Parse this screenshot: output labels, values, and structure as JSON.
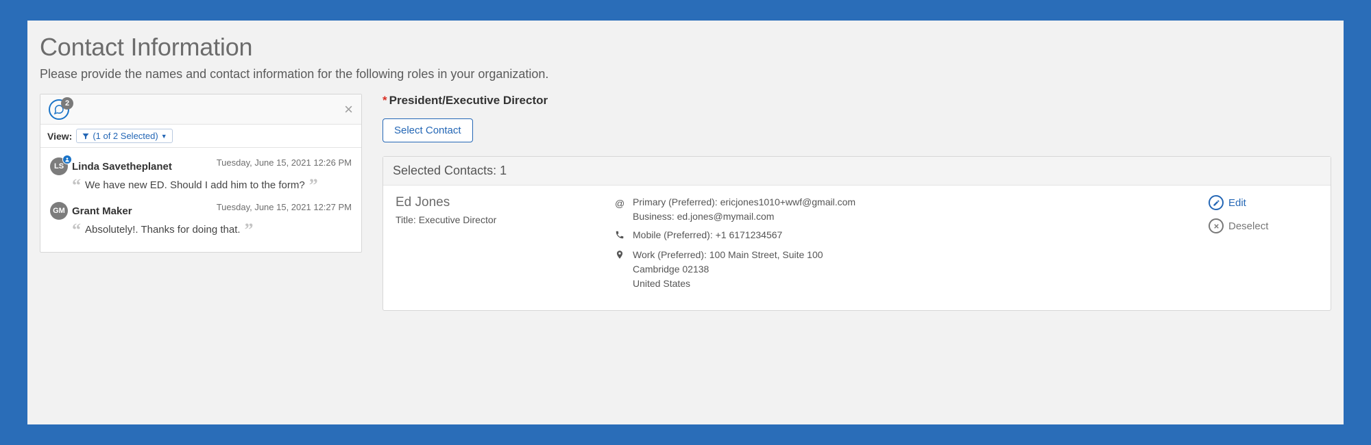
{
  "page": {
    "title": "Contact Information",
    "subtitle": "Please provide the names and contact information for the following roles in your organization."
  },
  "comments": {
    "badge_count": "2",
    "view_label": "View:",
    "filter_text": "(1 of 2 Selected)",
    "items": [
      {
        "initials": "LS",
        "has_user_badge": true,
        "name": "Linda Savetheplanet",
        "timestamp": "Tuesday, June 15, 2021 12:26 PM",
        "body": "We have new ED. Should I add him to the form?"
      },
      {
        "initials": "GM",
        "has_user_badge": false,
        "name": "Grant Maker",
        "timestamp": "Tuesday, June 15, 2021 12:27 PM",
        "body": "Absolutely!. Thanks for doing that."
      }
    ]
  },
  "role": {
    "label": "President/Executive Director",
    "select_button": "Select Contact"
  },
  "selected": {
    "header_prefix": "Selected Contacts:",
    "count": "1",
    "contact_name": "Ed Jones",
    "contact_title": "Title: Executive Director",
    "email_primary": "Primary (Preferred): ericjones1010+wwf@gmail.com",
    "email_business": "Business: ed.jones@mymail.com",
    "phone": "Mobile (Preferred): +1 6171234567",
    "address_line1": "Work (Preferred): 100 Main Street, Suite 100",
    "address_line2": "Cambridge 02138",
    "address_line3": "United States",
    "edit_label": "Edit",
    "deselect_label": "Deselect"
  }
}
